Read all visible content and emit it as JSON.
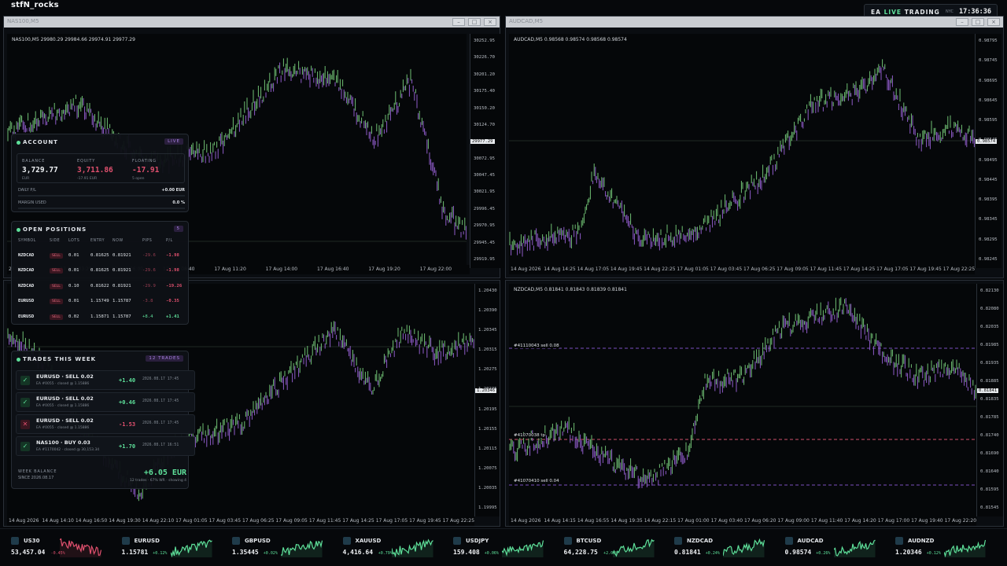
{
  "app": {
    "title": "stfN_rocks"
  },
  "ea_badge": {
    "prefix": "EA",
    "live": "LIVE",
    "suffix": "TRADING",
    "tz": "NYC",
    "time": "17:36:36"
  },
  "windows": {
    "nas": {
      "title": "NAS100,M5",
      "label": "NAS100,M5  29980.29 29984.66 29974.91 29977.29",
      "price_ticks": [
        "30252.95",
        "30226.70",
        "30201.20",
        "30175.40",
        "30150.20",
        "30124.70",
        "30099.20",
        "30072.95",
        "30047.45",
        "30021.95",
        "29996.45",
        "29970.95",
        "29945.45",
        "29919.95"
      ],
      "price_tag": "29977.29",
      "time_ticks": [
        "23:40",
        "17 Aug 03:20",
        "17 Aug 06:00",
        "17 Aug 08:40",
        "17 Aug 11:20",
        "17 Aug 14:00",
        "17 Aug 16:40",
        "17 Aug 19:20",
        "17 Aug 22:00"
      ]
    },
    "audcad": {
      "title": "AUDCAD,M5",
      "label": "AUDCAD,M5  0.98568 0.98574 0.98568 0.98574",
      "price_ticks": [
        "0.98795",
        "0.98745",
        "0.98695",
        "0.98645",
        "0.98595",
        "0.98545",
        "0.98495",
        "0.98445",
        "0.98395",
        "0.98345",
        "0.98295",
        "0.98245"
      ],
      "price_tag": "0.98574",
      "time_ticks": [
        "14 Aug 2026",
        "14 Aug 14:25",
        "14 Aug 17:05",
        "14 Aug 19:45",
        "14 Aug 22:25",
        "17 Aug 01:05",
        "17 Aug 03:45",
        "17 Aug 06:25",
        "17 Aug 09:05",
        "17 Aug 11:45",
        "17 Aug 14:25",
        "17 Aug 17:05",
        "17 Aug 19:45",
        "17 Aug 22:25"
      ]
    },
    "eurusd": {
      "price_ticks": [
        "1.20430",
        "1.20390",
        "1.20345",
        "1.20315",
        "1.20275",
        "1.20235",
        "1.20195",
        "1.20155",
        "1.20115",
        "1.20075",
        "1.20035",
        "1.19995"
      ],
      "price_tag": "1.20346",
      "time_ticks": [
        "14 Aug 2026",
        "14 Aug 14:10",
        "14 Aug 16:50",
        "14 Aug 19:30",
        "14 Aug 22:10",
        "17 Aug 01:05",
        "17 Aug 03:45",
        "17 Aug 06:25",
        "17 Aug 09:05",
        "17 Aug 11:45",
        "17 Aug 14:25",
        "17 Aug 17:05",
        "17 Aug 19:45",
        "17 Aug 22:25"
      ]
    },
    "nzdcad": {
      "title": "NZDCAD,M5",
      "label": "NZDCAD,M5  0.81841 0.81843 0.81839 0.81841",
      "price_ticks": [
        "0.82130",
        "0.82080",
        "0.82035",
        "0.81985",
        "0.81935",
        "0.81885",
        "0.81835",
        "0.81785",
        "0.81740",
        "0.81690",
        "0.81640",
        "0.81595",
        "0.81545"
      ],
      "price_tag": "0.81841",
      "time_ticks": [
        "14 Aug 2026",
        "14 Aug 14:15",
        "14 Aug 16:55",
        "14 Aug 19:35",
        "14 Aug 22:15",
        "17 Aug 01:00",
        "17 Aug 03:40",
        "17 Aug 06:20",
        "17 Aug 09:00",
        "17 Aug 11:40",
        "17 Aug 14:20",
        "17 Aug 17:00",
        "17 Aug 19:40",
        "17 Aug 22:20"
      ],
      "orders": [
        "#41110043 sell 0.08",
        "#41070038 tp",
        "#41070410 sell 0.04"
      ]
    }
  },
  "account": {
    "title": "ACCOUNT",
    "tag": "LIVE",
    "balance_label": "BALANCE",
    "balance": "3,729.77",
    "balance_sub": "EUR",
    "equity_label": "EQUITY",
    "equity": "3,711.86",
    "equity_sub": "-17.91 EUR",
    "floating_label": "FLOATING",
    "floating": "-17.91",
    "floating_sub": "5 open",
    "daily_label": "DAILY P/L",
    "daily_value": "+0.00 EUR",
    "margin_label": "MARGIN USED",
    "margin_value": "0.0 %"
  },
  "positions": {
    "title": "OPEN POSITIONS",
    "count": "5",
    "headers": [
      "SYMBOL",
      "SIDE",
      "LOTS",
      "ENTRY",
      "NOW",
      "PIPS",
      "P/L"
    ],
    "rows": [
      {
        "symbol": "NZDCAD",
        "side": "SELL",
        "lots": "0.01",
        "entry": "0.81625",
        "now": "0.81921",
        "pips": "-29.6",
        "pl": "-1.98"
      },
      {
        "symbol": "NZDCAD",
        "side": "SELL",
        "lots": "0.01",
        "entry": "0.81625",
        "now": "0.81921",
        "pips": "-29.6",
        "pl": "-1.98"
      },
      {
        "symbol": "NZDCAD",
        "side": "SELL",
        "lots": "0.10",
        "entry": "0.81622",
        "now": "0.81921",
        "pips": "-29.9",
        "pl": "-19.26"
      },
      {
        "symbol": "EURUSD",
        "side": "SELL",
        "lots": "0.01",
        "entry": "1.15749",
        "now": "1.15787",
        "pips": "-3.8",
        "pl": "-0.35"
      },
      {
        "symbol": "EURUSD",
        "side": "SELL",
        "lots": "0.02",
        "entry": "1.15871",
        "now": "1.15787",
        "pips": "+8.4",
        "pl": "+1.41"
      }
    ]
  },
  "trades": {
    "title": "TRADES THIS WEEK",
    "tag": "12 TRADES",
    "rows": [
      {
        "title": "EURUSD · SELL 0.02",
        "sub": "EA #0055 · closed @ 1.15886",
        "pl": "+1.40",
        "time": "2026.08.17 17:45",
        "win": true
      },
      {
        "title": "EURUSD · SELL 0.02",
        "sub": "EA #0055 · closed @ 1.15886",
        "pl": "+0.46",
        "time": "2026.08.17 17:45",
        "win": true
      },
      {
        "title": "EURUSD · SELL 0.02",
        "sub": "EA #0055 · closed @ 1.15886",
        "pl": "-1.53",
        "time": "2026.08.17 17:45",
        "win": false
      },
      {
        "title": "NAS100 · BUY 0.03",
        "sub": "EA #1170042 · closed @ 30,153.34",
        "pl": "+1.70",
        "time": "2026.08.17 16:51",
        "win": true
      }
    ],
    "week_label": "WEEK BALANCE",
    "since": "SINCE 2026.08.17",
    "week_value": "+6.05 EUR",
    "week_sub": "12 trades · 67% WR · showing 4"
  },
  "ticker": [
    {
      "symbol": "US30",
      "price": "53,457.04",
      "change": "-0.45%",
      "color": "#e0506e"
    },
    {
      "symbol": "EURUSD",
      "price": "1.15781",
      "change": "+0.12%",
      "color": "#5ee09a"
    },
    {
      "symbol": "GBPUSD",
      "price": "1.35445",
      "change": "+0.02%",
      "color": "#5ee09a"
    },
    {
      "symbol": "XAUUSD",
      "price": "4,416.64",
      "change": "+0.79%",
      "color": "#5ee09a"
    },
    {
      "symbol": "USDJPY",
      "price": "159.408",
      "change": "+0.06%",
      "color": "#5ee09a"
    },
    {
      "symbol": "BTCUSD",
      "price": "64,228.75",
      "change": "+2.05%",
      "color": "#5ee09a"
    },
    {
      "symbol": "NZDCAD",
      "price": "0.81841",
      "change": "+0.24%",
      "color": "#5ee09a"
    },
    {
      "symbol": "AUDCAD",
      "price": "0.98574",
      "change": "+0.26%",
      "color": "#5ee09a"
    },
    {
      "symbol": "AUDNZD",
      "price": "1.20346",
      "change": "+0.12%",
      "color": "#5ee09a"
    }
  ],
  "colors": {
    "up": "#6fbf73",
    "down": "#8e5bc9",
    "profit": "#5ee09a",
    "loss": "#e0506e"
  }
}
